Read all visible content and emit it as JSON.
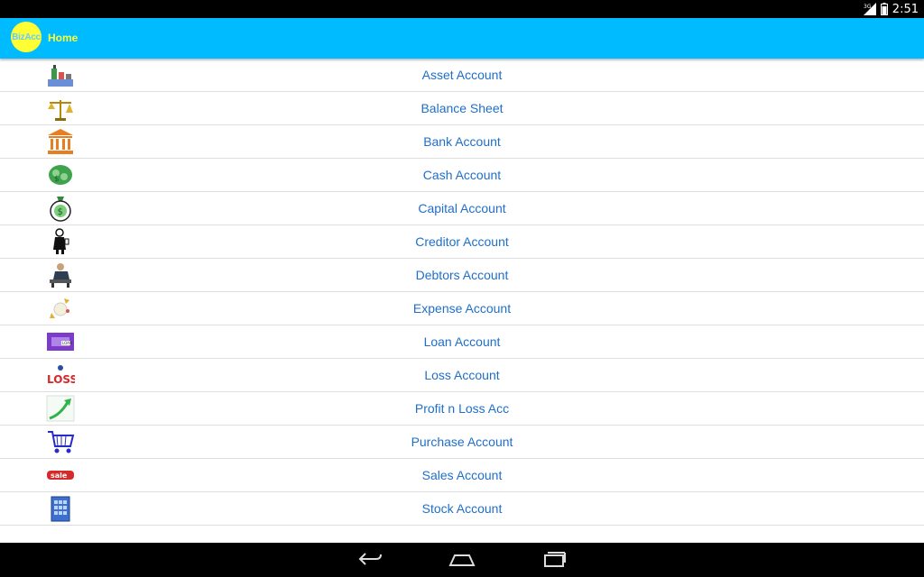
{
  "status_bar": {
    "network": "3G",
    "time": "2:51"
  },
  "app_bar": {
    "logo_text": "BizAcc",
    "title": "Home"
  },
  "items": [
    {
      "label": "Asset Account",
      "icon": "asset-icon"
    },
    {
      "label": "Balance Sheet",
      "icon": "balance-scale-icon"
    },
    {
      "label": "Bank Account",
      "icon": "bank-icon"
    },
    {
      "label": "Cash Account",
      "icon": "cash-icon"
    },
    {
      "label": "Capital Account",
      "icon": "money-bag-icon"
    },
    {
      "label": "Creditor Account",
      "icon": "creditor-icon"
    },
    {
      "label": "Debtors Account",
      "icon": "debtor-icon"
    },
    {
      "label": "Expense Account",
      "icon": "expense-icon"
    },
    {
      "label": "Loan Account",
      "icon": "loan-icon"
    },
    {
      "label": "Loss Account",
      "icon": "loss-icon"
    },
    {
      "label": "Profit n Loss Acc",
      "icon": "profit-arrow-icon"
    },
    {
      "label": "Purchase Account",
      "icon": "shopping-cart-icon"
    },
    {
      "label": "Sales Account",
      "icon": "sale-tag-icon"
    },
    {
      "label": "Stock Account",
      "icon": "stock-building-icon"
    }
  ],
  "colors": {
    "app_bar": "#00bbff",
    "title": "#ffff33",
    "item_text": "#1f6fc9"
  }
}
